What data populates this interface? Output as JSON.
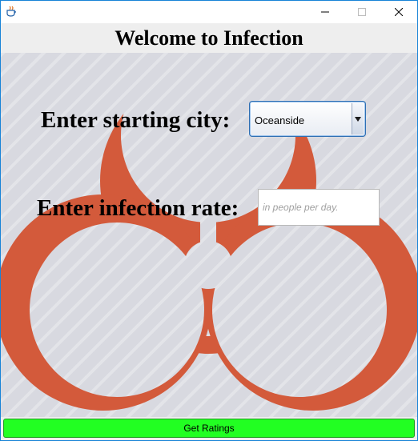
{
  "window": {
    "app_icon": "java-coffee-cup-icon",
    "controls": {
      "minimize_icon": "minimize-icon",
      "maximize_icon": "maximize-icon",
      "close_icon": "close-icon"
    }
  },
  "header": {
    "title": "Welcome to Infection"
  },
  "background": {
    "image": "biohazard-symbol",
    "symbol_color": "#d35a3b",
    "panel_color": "#d8d9e0"
  },
  "form": {
    "city_label": "Enter starting city:",
    "city_select": {
      "value": "Oceanside",
      "arrow_icon": "triangle-down-icon"
    },
    "rate_label": "Enter infection rate:",
    "rate_input": {
      "value": "",
      "placeholder": "in people per day."
    }
  },
  "actions": {
    "get_ratings_label": "Get Ratings",
    "button_color": "#22ff22"
  }
}
